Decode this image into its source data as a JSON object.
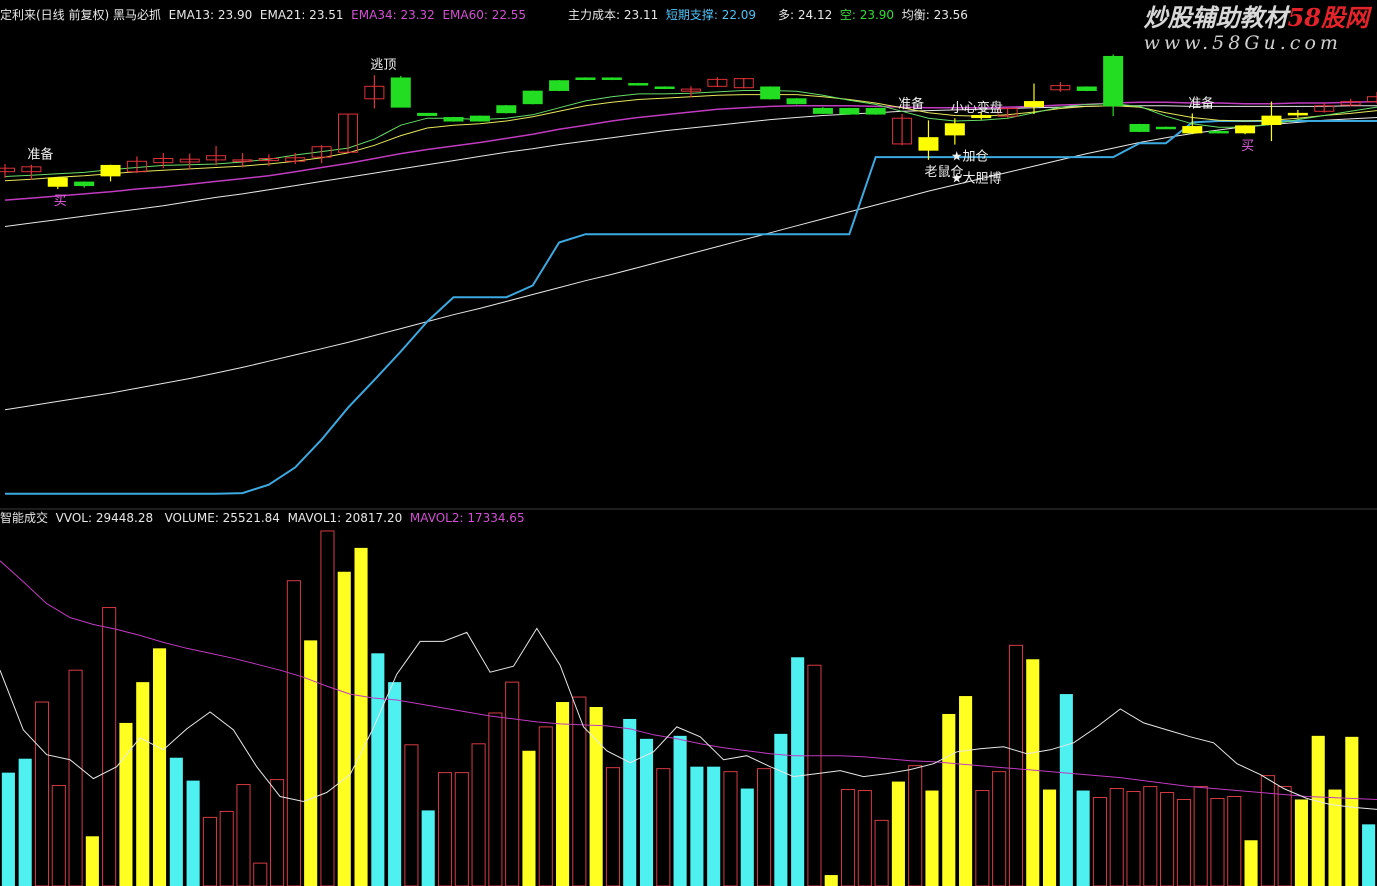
{
  "top_info": {
    "title": "定利来(日线 前复权) 黑马必抓",
    "ema13_label": "EMA13: 23.90",
    "ema21_label": "EMA21: 23.51",
    "ema34_label": "EMA34: 23.32",
    "ema60_label": "EMA60: 22.55",
    "main_cost_label": "主力成本: 23.11",
    "support_label": "短期支撑: 22.09",
    "duo_label": "多: 24.12",
    "kong_label": "空: 23.90",
    "balance_label": "均衡: 23.56"
  },
  "vol_info": {
    "title": "智能成交",
    "vvol_label": "VVOL: 29448.28",
    "volume_label": "VOLUME: 25521.84",
    "mavol1_label": "MAVOL1: 20817.20",
    "mavol2_label": "MAVOL2: 17334.65"
  },
  "watermark": {
    "line1_a": "炒股辅助教材",
    "line1_b": "58股网",
    "line2": "www.58Gu.com"
  },
  "colors": {
    "background": "#000000",
    "candle_up": "#e0303a",
    "candle_down": "#22dd22",
    "candle_signal": "#ffff00",
    "vol_up": "#d63a44",
    "vol_down": "#4ff0f0",
    "vol_signal": "#ffff22",
    "support_line": "#3ca9e0",
    "ema34": "#c03bc0",
    "ma_white": "#e8e8e8",
    "ma_yellow": "#e6e65a",
    "ma_green": "#66dd66"
  },
  "chart_data": [
    {
      "type": "candlestick",
      "name": "price",
      "ylim": [
        18.9,
        25.7
      ],
      "ohlc": [
        [
          23.63,
          23.68,
          23.54,
          23.74,
          "u"
        ],
        [
          23.63,
          23.7,
          23.51,
          23.73,
          "u"
        ],
        [
          23.42,
          23.54,
          23.38,
          23.55,
          "y"
        ],
        [
          23.48,
          23.43,
          23.4,
          23.49,
          "g"
        ],
        [
          23.57,
          23.72,
          23.49,
          23.73,
          "y"
        ],
        [
          23.63,
          23.78,
          23.61,
          23.85,
          "u"
        ],
        [
          23.76,
          23.82,
          23.68,
          23.9,
          "u"
        ],
        [
          23.77,
          23.81,
          23.66,
          23.89,
          "u"
        ],
        [
          23.8,
          23.86,
          23.72,
          24.0,
          "u"
        ],
        [
          23.78,
          23.8,
          23.69,
          23.9,
          "u"
        ],
        [
          23.79,
          23.82,
          23.71,
          23.88,
          "u"
        ],
        [
          23.78,
          23.83,
          23.74,
          23.9,
          "u"
        ],
        [
          23.84,
          23.99,
          23.75,
          24.01,
          "u"
        ],
        [
          23.91,
          24.46,
          23.91,
          24.46,
          "u"
        ],
        [
          24.68,
          24.86,
          24.54,
          25.02,
          "u"
        ],
        [
          24.98,
          24.56,
          24.56,
          25.01,
          "g"
        ],
        [
          24.47,
          24.44,
          24.43,
          24.47,
          "g"
        ],
        [
          24.41,
          24.36,
          24.35,
          24.42,
          "g"
        ],
        [
          24.43,
          24.36,
          24.35,
          24.44,
          "g"
        ],
        [
          24.58,
          24.48,
          24.47,
          24.59,
          "g"
        ],
        [
          24.79,
          24.61,
          24.6,
          24.8,
          "g"
        ],
        [
          24.94,
          24.8,
          24.79,
          24.95,
          "g"
        ],
        [
          24.98,
          24.96,
          24.95,
          24.99,
          "g"
        ],
        [
          24.98,
          24.96,
          24.95,
          24.99,
          "g"
        ],
        [
          24.9,
          24.88,
          24.87,
          24.91,
          "g"
        ],
        [
          24.85,
          24.83,
          24.82,
          24.86,
          "g"
        ],
        [
          24.79,
          24.82,
          24.7,
          24.86,
          "u"
        ],
        [
          24.86,
          24.96,
          24.85,
          24.99,
          "u"
        ],
        [
          24.84,
          24.97,
          24.83,
          24.98,
          "u"
        ],
        [
          24.85,
          24.68,
          24.67,
          24.86,
          "g"
        ],
        [
          24.68,
          24.61,
          24.6,
          24.69,
          "g"
        ],
        [
          24.54,
          24.47,
          24.46,
          24.56,
          "g"
        ],
        [
          24.54,
          24.46,
          24.45,
          24.55,
          "g"
        ],
        [
          24.54,
          24.46,
          24.45,
          24.55,
          "g"
        ],
        [
          24.4,
          24.03,
          24.01,
          24.46,
          "u"
        ],
        [
          24.12,
          23.94,
          23.8,
          24.37,
          "y"
        ],
        [
          24.32,
          24.16,
          24.02,
          24.4,
          "y"
        ],
        [
          24.41,
          24.44,
          24.38,
          24.49,
          "y"
        ],
        [
          24.43,
          24.54,
          24.41,
          24.55,
          "u"
        ],
        [
          24.57,
          24.64,
          24.46,
          24.9,
          "y"
        ],
        [
          24.81,
          24.87,
          24.78,
          24.92,
          "u"
        ],
        [
          24.85,
          24.8,
          24.79,
          24.86,
          "g"
        ],
        [
          25.29,
          24.58,
          24.43,
          25.32,
          "g"
        ],
        [
          24.31,
          24.21,
          24.2,
          24.32,
          "g"
        ],
        [
          24.27,
          24.26,
          24.25,
          24.28,
          "g"
        ],
        [
          24.28,
          24.19,
          24.17,
          24.47,
          "y"
        ],
        [
          24.21,
          24.19,
          24.18,
          24.22,
          "g"
        ],
        [
          24.29,
          24.19,
          24.17,
          24.3,
          "y"
        ],
        [
          24.43,
          24.31,
          24.07,
          24.64,
          "y"
        ],
        [
          24.46,
          24.47,
          24.41,
          24.52,
          "y"
        ],
        [
          24.5,
          24.58,
          24.48,
          24.62,
          "u"
        ],
        [
          24.59,
          24.64,
          24.57,
          24.68,
          "u"
        ],
        [
          24.64,
          24.71,
          24.61,
          24.78,
          "u"
        ]
      ],
      "main_cost": [
        18.99,
        18.99,
        18.99,
        18.99,
        18.99,
        18.99,
        18.99,
        18.99,
        18.99,
        19.0,
        19.12,
        19.37,
        19.77,
        20.23,
        20.63,
        21.04,
        21.47,
        21.82,
        21.82,
        21.82,
        21.99,
        22.61,
        22.73,
        22.73,
        22.73,
        22.73,
        22.73,
        22.73,
        22.73,
        22.73,
        22.73,
        22.73,
        22.73,
        23.84,
        23.84,
        23.84,
        23.84,
        23.84,
        23.84,
        23.84,
        23.84,
        23.84,
        23.84,
        24.04,
        24.04,
        24.34,
        24.36,
        24.36,
        24.36,
        24.36,
        24.36,
        24.36,
        24.36
      ],
      "ema13": [
        23.56,
        23.58,
        23.6,
        23.62,
        23.66,
        23.69,
        23.72,
        23.73,
        23.74,
        23.77,
        23.81,
        23.87,
        23.92,
        23.97,
        24.1,
        24.3,
        24.4,
        24.4,
        24.38,
        24.4,
        24.45,
        24.55,
        24.65,
        24.71,
        24.75,
        24.75,
        24.76,
        24.78,
        24.8,
        24.8,
        24.79,
        24.73,
        24.66,
        24.6,
        24.5,
        24.4,
        24.36,
        24.37,
        24.4,
        24.48,
        24.56,
        24.6,
        24.61,
        24.57,
        24.43,
        24.32,
        24.27,
        24.27,
        24.31,
        24.38,
        24.44,
        24.5,
        24.56
      ],
      "ema21": [
        23.5,
        23.52,
        23.55,
        23.57,
        23.6,
        23.63,
        23.65,
        23.67,
        23.69,
        23.71,
        23.74,
        23.78,
        23.83,
        23.9,
        24.01,
        24.15,
        24.26,
        24.3,
        24.32,
        24.36,
        24.42,
        24.5,
        24.58,
        24.63,
        24.67,
        24.69,
        24.71,
        24.73,
        24.74,
        24.74,
        24.74,
        24.71,
        24.67,
        24.62,
        24.55,
        24.48,
        24.44,
        24.43,
        24.45,
        24.49,
        24.54,
        24.57,
        24.58,
        24.56,
        24.48,
        24.41,
        24.37,
        24.36,
        24.37,
        24.4,
        24.44,
        24.47,
        24.51
      ],
      "ema34": [
        23.22,
        23.25,
        23.28,
        23.31,
        23.34,
        23.38,
        23.41,
        23.45,
        23.49,
        23.53,
        23.57,
        23.63,
        23.69,
        23.75,
        23.82,
        23.89,
        23.95,
        24.0,
        24.05,
        24.11,
        24.17,
        24.24,
        24.3,
        24.36,
        24.41,
        24.45,
        24.49,
        24.53,
        24.55,
        24.57,
        24.58,
        24.58,
        24.58,
        24.57,
        24.56,
        24.55,
        24.55,
        24.55,
        24.56,
        24.57,
        24.59,
        24.6,
        24.62,
        24.63,
        24.63,
        24.62,
        24.62,
        24.61,
        24.61,
        24.62,
        24.62,
        24.63,
        24.64
      ],
      "ema60": [
        22.84,
        22.89,
        22.94,
        22.99,
        23.04,
        23.09,
        23.14,
        23.2,
        23.26,
        23.31,
        23.37,
        23.43,
        23.49,
        23.55,
        23.61,
        23.67,
        23.73,
        23.79,
        23.85,
        23.91,
        23.96,
        24.02,
        24.07,
        24.12,
        24.17,
        24.22,
        24.26,
        24.3,
        24.34,
        24.38,
        24.41,
        24.44,
        24.46,
        24.48,
        24.5,
        24.51,
        24.52,
        24.53,
        24.54,
        24.55,
        24.56,
        24.57,
        24.58,
        24.58,
        24.58,
        24.57,
        24.57,
        24.57,
        24.57,
        24.57,
        24.57,
        24.58,
        24.58
      ],
      "ma_long": [
        20.2,
        20.26,
        20.32,
        20.38,
        20.44,
        20.51,
        20.58,
        20.65,
        20.73,
        20.81,
        20.9,
        20.99,
        21.08,
        21.17,
        21.27,
        21.37,
        21.47,
        21.57,
        21.66,
        21.76,
        21.86,
        21.96,
        22.06,
        22.15,
        22.25,
        22.35,
        22.45,
        22.55,
        22.65,
        22.75,
        22.85,
        22.95,
        23.05,
        23.15,
        23.25,
        23.35,
        23.44,
        23.53,
        23.62,
        23.71,
        23.8,
        23.89,
        23.97,
        24.05,
        24.12,
        24.18,
        24.23,
        24.28,
        24.31,
        24.34,
        24.37,
        24.39,
        24.41
      ],
      "labels": [
        {
          "i": 1,
          "text": "准备",
          "pos": "above"
        },
        {
          "i": 2,
          "text": "买",
          "pos": "below"
        },
        {
          "i": 14,
          "text": "逃顶",
          "pos": "above"
        },
        {
          "i": 34,
          "text": "准备",
          "pos": "above"
        },
        {
          "i": 35,
          "text": "老鼠仓",
          "pos": "below"
        },
        {
          "i": 36,
          "text": "小心变盘",
          "pos": "above"
        },
        {
          "i": 36,
          "text": "★加仓",
          "pos": "below"
        },
        {
          "i": 36,
          "text": "★大胆博",
          "pos": "below2"
        },
        {
          "i": 45,
          "text": "准备",
          "pos": "above"
        },
        {
          "i": 47,
          "text": "买",
          "pos": "below"
        }
      ]
    },
    {
      "type": "bar",
      "name": "volume",
      "ylim": [
        0,
        36000
      ],
      "values": [
        [
          11400,
          "c"
        ],
        [
          12800,
          "c"
        ],
        [
          18500,
          "r"
        ],
        [
          10100,
          "r"
        ],
        [
          21700,
          "r"
        ],
        [
          5000,
          "y"
        ],
        [
          28000,
          "r"
        ],
        [
          16400,
          "y"
        ],
        [
          20500,
          "y"
        ],
        [
          23900,
          "y"
        ],
        [
          12900,
          "c"
        ],
        [
          10600,
          "c"
        ],
        [
          6900,
          "r"
        ],
        [
          7500,
          "r"
        ],
        [
          10200,
          "r"
        ],
        [
          2300,
          "r"
        ],
        [
          10700,
          "r"
        ],
        [
          30700,
          "r"
        ],
        [
          24700,
          "y"
        ],
        [
          35700,
          "r"
        ],
        [
          31600,
          "y"
        ],
        [
          34000,
          "y"
        ],
        [
          23400,
          "c"
        ],
        [
          20500,
          "c"
        ],
        [
          14200,
          "r"
        ],
        [
          7600,
          "c"
        ],
        [
          11400,
          "r"
        ],
        [
          11400,
          "r"
        ],
        [
          14300,
          "r"
        ],
        [
          17400,
          "r"
        ],
        [
          20500,
          "r"
        ],
        [
          13600,
          "y"
        ],
        [
          16000,
          "r"
        ],
        [
          18500,
          "y"
        ],
        [
          19000,
          "r"
        ],
        [
          18000,
          "y"
        ],
        [
          11900,
          "r"
        ],
        [
          16800,
          "c"
        ],
        [
          14800,
          "c"
        ],
        [
          11800,
          "r"
        ],
        [
          15100,
          "c"
        ],
        [
          12000,
          "c"
        ],
        [
          12000,
          "c"
        ],
        [
          11500,
          "r"
        ],
        [
          9800,
          "c"
        ],
        [
          11800,
          "r"
        ],
        [
          15300,
          "c"
        ],
        [
          23000,
          "c"
        ],
        [
          22200,
          "r"
        ],
        [
          1100,
          "y"
        ],
        [
          9700,
          "r"
        ],
        [
          9600,
          "r"
        ],
        [
          6600,
          "r"
        ],
        [
          10500,
          "y"
        ],
        [
          12100,
          "r"
        ],
        [
          9600,
          "y"
        ],
        [
          17300,
          "y"
        ],
        [
          19100,
          "y"
        ],
        [
          9600,
          "r"
        ],
        [
          11500,
          "r"
        ],
        [
          24200,
          "r"
        ],
        [
          22800,
          "y"
        ],
        [
          9700,
          "y"
        ],
        [
          19300,
          "c"
        ],
        [
          9600,
          "c"
        ],
        [
          8900,
          "r"
        ],
        [
          9800,
          "r"
        ],
        [
          9500,
          "r"
        ],
        [
          10000,
          "r"
        ],
        [
          9400,
          "r"
        ],
        [
          8700,
          "r"
        ],
        [
          10000,
          "r"
        ],
        [
          8800,
          "r"
        ],
        [
          9000,
          "r"
        ],
        [
          4600,
          "y"
        ],
        [
          11100,
          "r"
        ],
        [
          10000,
          "r"
        ],
        [
          8700,
          "y"
        ],
        [
          15100,
          "y"
        ],
        [
          9700,
          "y"
        ],
        [
          15000,
          "y"
        ],
        [
          6200,
          "c"
        ]
      ],
      "ma_white": [
        21700,
        15700,
        13200,
        12700,
        10800,
        12000,
        14900,
        13700,
        15800,
        17500,
        15700,
        12000,
        9000,
        8500,
        9400,
        11200,
        15900,
        21300,
        24600,
        24600,
        25500,
        21500,
        22100,
        25900,
        22200,
        16000,
        13600,
        12400,
        13500,
        16000,
        15000,
        12700,
        13100,
        12000,
        11000,
        11300,
        11600,
        11000,
        11300,
        11700,
        12300,
        13500,
        13800,
        14000,
        13300,
        13700,
        14400,
        16000,
        17800,
        16400,
        15700,
        15000,
        14400,
        12300,
        11200,
        9800,
        8800,
        8200,
        7900,
        7700
      ],
      "ma_magenta": [
        32700,
        30600,
        28400,
        27000,
        26300,
        25800,
        25200,
        24500,
        23900,
        23400,
        22900,
        22300,
        21700,
        21000,
        20100,
        19300,
        18900,
        18700,
        18300,
        17900,
        17500,
        17100,
        16800,
        16500,
        16300,
        16200,
        16100,
        15800,
        15200,
        14800,
        14300,
        13900,
        13600,
        13300,
        13100,
        13100,
        13100,
        13000,
        12800,
        12600,
        12500,
        12300,
        12100,
        11900,
        11700,
        11500,
        11300,
        11100,
        10900,
        10600,
        10300,
        10000,
        9800,
        9600,
        9400,
        9200,
        9000,
        8900,
        8800,
        8700
      ]
    }
  ]
}
